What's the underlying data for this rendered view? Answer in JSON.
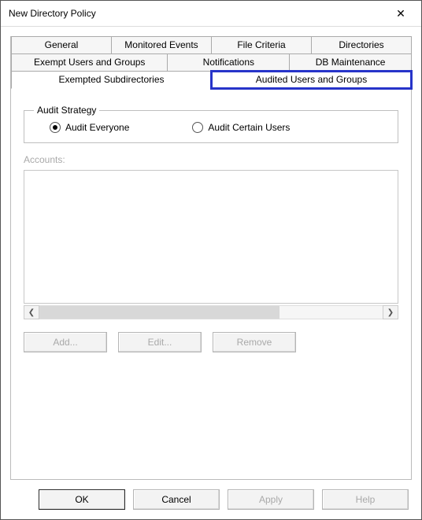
{
  "window": {
    "title": "New Directory Policy",
    "close_label": "✕"
  },
  "tabs": {
    "row1": [
      "General",
      "Monitored Events",
      "File Criteria",
      "Directories"
    ],
    "row2": [
      "Exempt Users and Groups",
      "Notifications",
      "DB Maintenance"
    ],
    "row3": [
      "Exempted Subdirectories",
      "Audited Users and Groups"
    ]
  },
  "strategy": {
    "legend": "Audit Strategy",
    "opt_everyone": "Audit Everyone",
    "opt_certain": "Audit Certain Users"
  },
  "accounts": {
    "label": "Accounts:"
  },
  "buttons": {
    "add": "Add...",
    "edit": "Edit...",
    "remove": "Remove"
  },
  "dialog": {
    "ok": "OK",
    "cancel": "Cancel",
    "apply": "Apply",
    "help": "Help"
  },
  "scroll": {
    "left": "❮",
    "right": "❯"
  }
}
